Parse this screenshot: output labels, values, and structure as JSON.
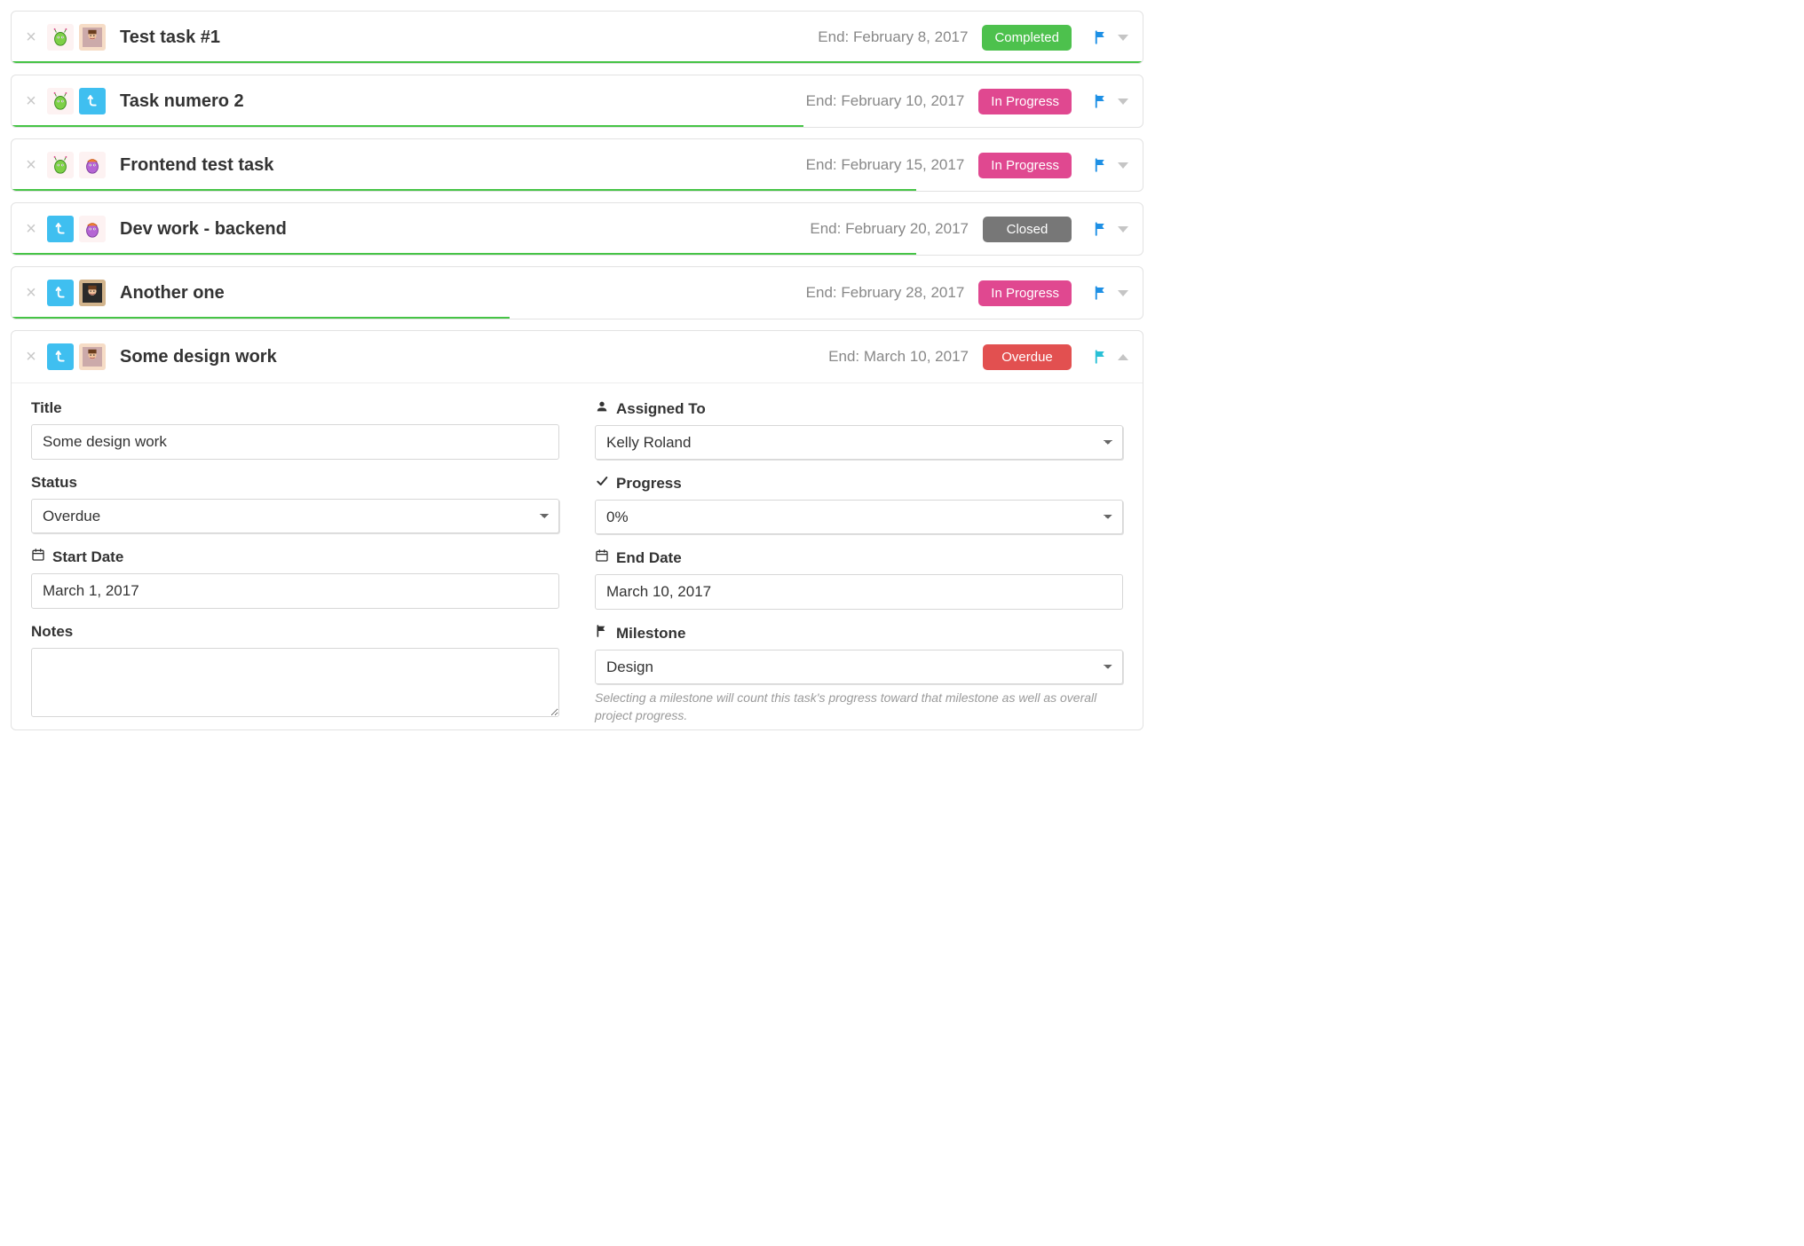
{
  "tasks": [
    {
      "title": "Test task #1",
      "end_label": "End: February 8, 2017",
      "status_label": "Completed",
      "status_class": "status-completed",
      "progress_pct": 100,
      "flag_color": "#1e90e5",
      "avatars": [
        "monster",
        "face1"
      ],
      "expanded": false
    },
    {
      "title": "Task numero 2",
      "end_label": "End: February 10, 2017",
      "status_label": "In Progress",
      "status_class": "status-inprogress",
      "progress_pct": 70,
      "flag_color": "#1e90e5",
      "avatars": [
        "monster",
        "arrow-turn"
      ],
      "expanded": false
    },
    {
      "title": "Frontend test task",
      "end_label": "End: February 15, 2017",
      "status_label": "In Progress",
      "status_class": "status-inprogress",
      "progress_pct": 80,
      "flag_color": "#1e90e5",
      "avatars": [
        "monster",
        "monster2"
      ],
      "expanded": false
    },
    {
      "title": "Dev work - backend",
      "end_label": "End: February 20, 2017",
      "status_label": "Closed",
      "status_class": "status-closed",
      "progress_pct": 80,
      "flag_color": "#1e90e5",
      "avatars": [
        "arrow-turn",
        "monster2"
      ],
      "expanded": false
    },
    {
      "title": "Another one",
      "end_label": "End: February 28, 2017",
      "status_label": "In Progress",
      "status_class": "status-inprogress",
      "progress_pct": 44,
      "flag_color": "#1e90e5",
      "avatars": [
        "arrow-turn",
        "face3"
      ],
      "expanded": false
    },
    {
      "title": "Some design work",
      "end_label": "End: March 10, 2017",
      "status_label": "Overdue",
      "status_class": "status-overdue",
      "progress_pct": 0,
      "flag_color": "#29c0d6",
      "avatars": [
        "arrow-turn",
        "face1"
      ],
      "expanded": true
    }
  ],
  "detail": {
    "labels": {
      "title": "Title",
      "status": "Status",
      "start_date": "Start Date",
      "notes": "Notes",
      "assigned_to": "Assigned To",
      "progress": "Progress",
      "end_date": "End Date",
      "milestone": "Milestone"
    },
    "values": {
      "title": "Some design work",
      "status": "Overdue",
      "start_date": "March 1, 2017",
      "notes": "",
      "assigned_to": "Kelly Roland",
      "progress": "0%",
      "end_date": "March 10, 2017",
      "milestone": "Design"
    },
    "milestone_helper": "Selecting a milestone will count this task's progress toward that milestone as well as overall project progress."
  }
}
